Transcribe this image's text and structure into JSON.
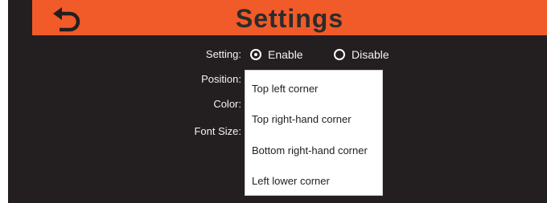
{
  "header": {
    "title": "Settings",
    "back_icon": "undo-arrow-icon"
  },
  "colors": {
    "header": "#f15a29",
    "background": "#231f20",
    "title_text": "#2b2b2b"
  },
  "form": {
    "setting_label": "Setting:",
    "enable_label": "Enable",
    "disable_label": "Disable",
    "selected": "Enable",
    "position_label": "Position:",
    "color_label": "Color:",
    "font_size_label": "Font Size:"
  },
  "position_options": [
    "Top left corner",
    "Top right-hand corner",
    "Bottom right-hand corner",
    "Left lower corner"
  ]
}
